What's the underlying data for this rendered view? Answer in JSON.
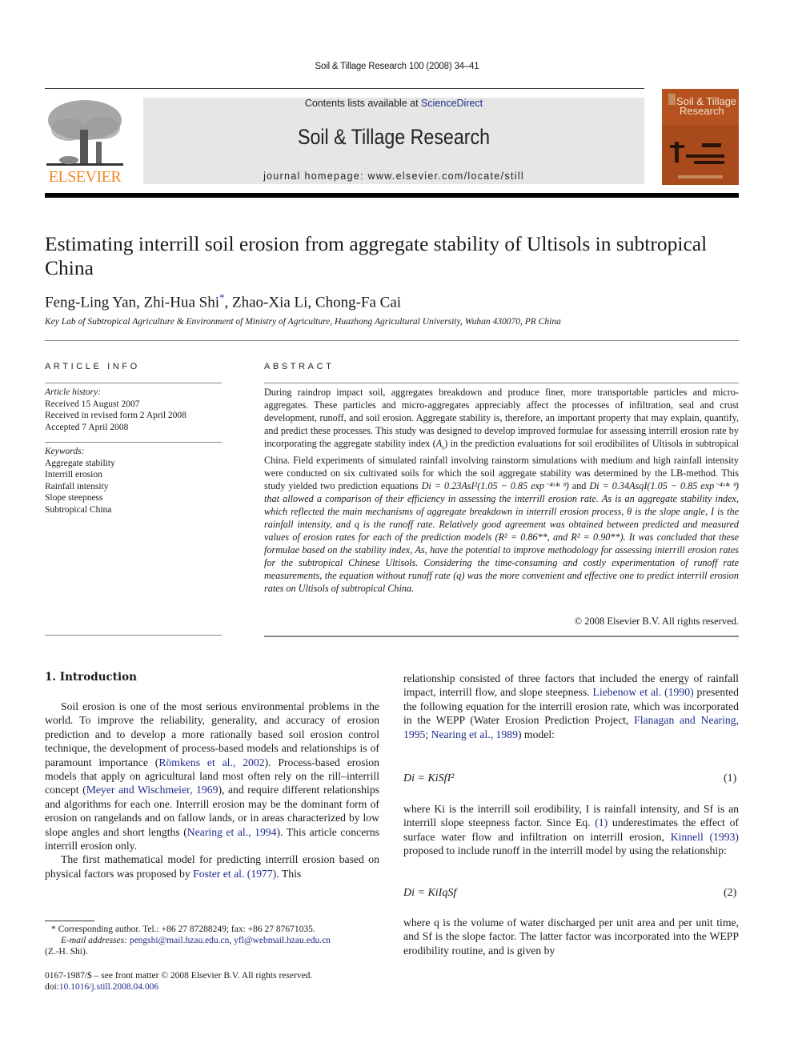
{
  "running_header": "Soil & Tillage Research 100 (2008) 34–41",
  "masthead": {
    "publisher_logo_text": "ELSEVIER",
    "contents_prefix": "Contents lists available at ",
    "contents_link": "ScienceDirect",
    "journal_title": "Soil & Tillage Research",
    "homepage": "journal homepage: www.elsevier.com/locate/still",
    "cover_title_line1": "Soil & Tillage",
    "cover_title_line2": "Research",
    "colors": {
      "elsevier_orange": "#f08a24",
      "cover_brown": "#b5521f",
      "banner_gray": "#e6e6e6",
      "link_blue": "#1f2d8c"
    }
  },
  "article": {
    "title": "Estimating interrill soil erosion from aggregate stability of Ultisols in subtropical China",
    "authors_a": "Feng-Ling Yan, Zhi-Hua Shi",
    "author_star": "*",
    "authors_b": ", Zhao-Xia Li, Chong-Fa Cai",
    "affiliation": "Key Lab of Subtropical Agriculture & Environment of Ministry of Agriculture, Huazhong Agricultural University, Wuhan 430070, PR China"
  },
  "article_info": {
    "heading": "ARTICLE INFO",
    "history_label": "Article history:",
    "history": [
      "Received 15 August 2007",
      "Received in revised form 2 April 2008",
      "Accepted 7 April 2008"
    ],
    "keywords_label": "Keywords:",
    "keywords": [
      "Aggregate stability",
      "Interrill erosion",
      "Rainfall intensity",
      "Slope steepness",
      "Subtropical China"
    ]
  },
  "abstract": {
    "heading": "ABSTRACT",
    "p1": "During raindrop impact soil, aggregates breakdown and produce finer, more transportable particles and micro-aggregates. These particles and micro-aggregates appreciably affect the processes of infiltration, seal and crust development, runoff, and soil erosion. Aggregate stability is, therefore, an important property that may explain, quantify, and predict these processes. This study was designed to develop improved formulae for assessing interrill erosion rate by incorporating the aggregate stability index (",
    "as1": "A",
    "p2": ") in the prediction evaluations for soil erodibilites of Ultisols in subtropical China. Field experiments of simulated rainfall involving rainstorm simulations with medium and high rainfall intensity were conducted on six cultivated soils for which the soil aggregate stability was determined by the LB-method. This study yielded two prediction equations ",
    "eq1": "Di = 0.23AsI²(1.05 − 0.85 exp⁻⁴ˢⁱⁿ ᶿ)",
    "p3": " and ",
    "eq2": "Di = 0.34AsqI(1.05 − 0.85 exp⁻⁴ˢⁱⁿ ᶿ)",
    "p4_italic": " that allowed a comparison of their efficiency in assessing the interrill erosion rate. As is an aggregate stability index, which reflected the main mechanisms of aggregate breakdown in interrill erosion process, θ is the slope angle, I is the rainfall intensity, and q is the runoff rate. Relatively good agreement was obtained between predicted and measured values of erosion rates for each of the prediction models (R² = 0.86**, and R² = 0.90**). It was concluded that these formulae based on the stability index, As, have the potential to improve methodology for assessing interrill erosion rates for the subtropical Chinese Ultisols. Considering the time-consuming and costly experimentation of runoff rate measurements, the equation without runoff rate (q) was the more convenient and effective one to predict interrill erosion rates on Ultisols of subtropical China.",
    "copyright": "© 2008 Elsevier B.V. All rights reserved."
  },
  "intro": {
    "heading": "1.  Introduction",
    "p1_a": "Soil erosion is one of the most serious environmental problems in the world. To improve the reliability, generality, and accuracy of erosion prediction and to develop a more rationally based soil erosion control technique, the development of process-based models and relationships is of paramount importance (",
    "cite1": "Römkens et al., 2002",
    "p1_b": "). Process-based erosion models that apply on agricultural land most often rely on the rill–interrill concept (",
    "cite2": "Meyer and Wischmeier, 1969",
    "p1_c": "), and require different relationships and algorithms for each one. Interrill erosion may be the dominant form of erosion on rangelands and on fallow lands, or in areas characterized by low slope angles and short lengths (",
    "cite3": "Nearing et al., 1994",
    "p1_d": "). This article concerns interrill erosion only.",
    "p2_a": "The first mathematical model for predicting interrill erosion based on physical factors was proposed by ",
    "cite4": "Foster et al. (1977)",
    "p2_b": ". This",
    "r1_a": "relationship consisted of three factors that included the energy of rainfall impact, interrill flow, and slope steepness. ",
    "cite5": "Liebenow et al. (1990)",
    "r1_b": " presented the following equation for the interrill erosion rate, which was incorporated in the WEPP (Water Erosion Prediction Project, ",
    "cite6": "Flanagan and Nearing, 1995; Nearing et al., 1989",
    "r1_c": ") model:",
    "eq1": "Di = KiSfI²",
    "eq1_num": "(1)",
    "r2_a": "where Ki is the interrill soil erodibility, I is rainfall intensity, and Sf is an interrill slope steepness factor. Since Eq. ",
    "cite7": "(1)",
    "r2_b": " underestimates the effect of surface water flow and infiltration on interrill erosion, ",
    "cite8": "Kinnell (1993)",
    "r2_c": " proposed to include runoff in the interrill model by using the relationship:",
    "eq2": "Di = KiIqSf",
    "eq2_num": "(2)",
    "r3": "where q is the volume of water discharged per unit area and per unit time, and Sf is the slope factor. The latter factor was incorporated into the WEPP erodibility routine, and is given by"
  },
  "footnotes": {
    "corresponding": "* Corresponding author. Tel.: +86 27 87288249; fax: +86 27 87671035.",
    "email_label": "E-mail addresses: ",
    "email1": "pengshi@mail.hzau.edu.cn",
    "email_sep": ", ",
    "email2": "yfl@webmail.hzau.edu.cn",
    "email_owner": "(Z.-H. Shi).",
    "issn": "0167-1987/$ – see front matter © 2008 Elsevier B.V. All rights reserved.",
    "doi_label": "doi:",
    "doi": "10.1016/j.still.2008.04.006"
  }
}
